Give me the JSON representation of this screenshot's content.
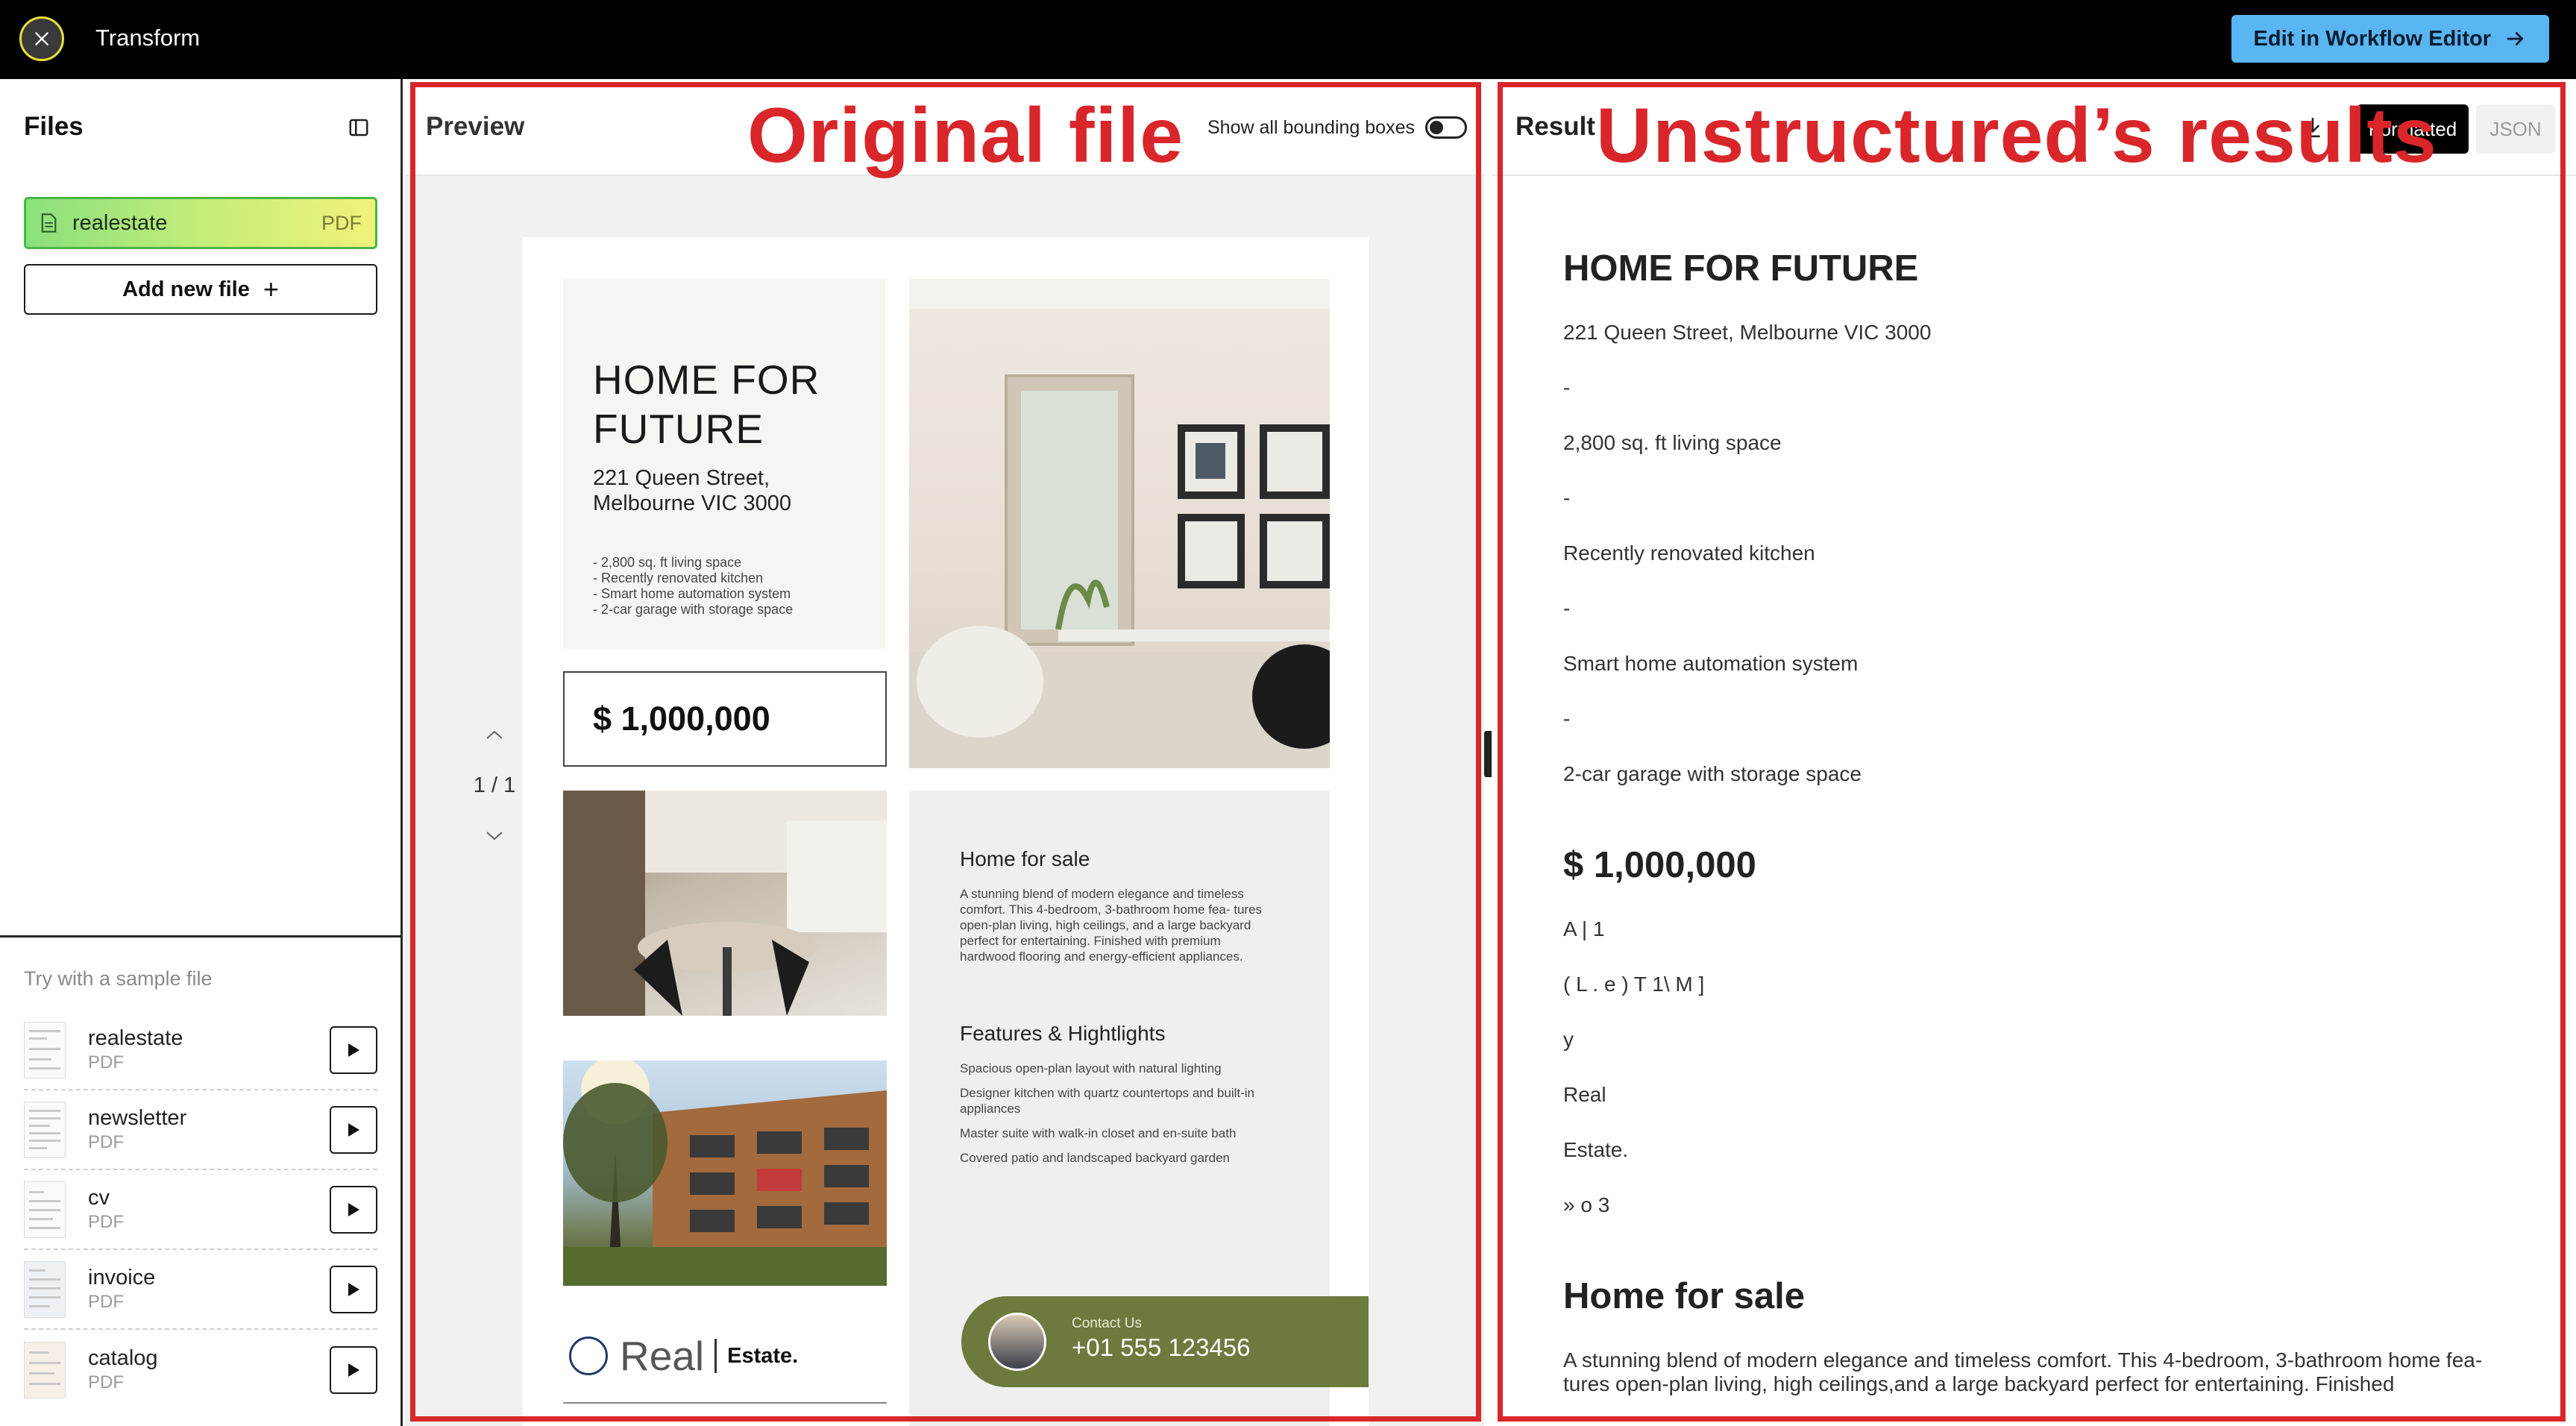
{
  "topbar": {
    "title": "Transform",
    "workflow_button": "Edit in Workflow Editor"
  },
  "sidebar": {
    "title": "Files",
    "active_file": {
      "name": "realestate",
      "type": "PDF"
    },
    "add_file_label": "Add new file",
    "sample_title": "Try with a sample file",
    "samples": [
      {
        "name": "realestate",
        "type": "PDF"
      },
      {
        "name": "newsletter",
        "type": "PDF"
      },
      {
        "name": "cv",
        "type": "PDF"
      },
      {
        "name": "invoice",
        "type": "PDF"
      },
      {
        "name": "catalog",
        "type": "PDF"
      }
    ]
  },
  "preview": {
    "title": "Preview",
    "bbox_label": "Show all bounding boxes",
    "page_count": "1 / 1",
    "document": {
      "heading_line1": "HOME FOR",
      "heading_line2": "FUTURE",
      "address_line1": "221 Queen Street,",
      "address_line2": "Melbourne VIC 3000",
      "bullets": [
        "- 2,800 sq. ft living space",
        "- Recently renovated kitchen",
        "- Smart home automation system",
        "- 2-car garage with storage space"
      ],
      "price": "$ 1,000,000",
      "sale_title": "Home for sale",
      "sale_text": "A stunning blend of modern elegance and timeless comfort. This 4-bedroom, 3-bathroom home fea- tures open-plan living, high ceilings, and a large backyard perfect for entertaining. Finished with premium hardwood flooring and energy-efficient appliances.",
      "features_title": "Features & Hightlights",
      "features": [
        "Spacious open-plan layout with natural lighting",
        "Designer kitchen with quartz countertops and built-in appliances",
        "Master suite with walk-in closet and en-suite bath",
        "Covered patio and landscaped backyard garden"
      ],
      "contact_label": "Contact Us",
      "contact_number": "+01 555 123456",
      "logo_real": "Real",
      "logo_estate": "Estate."
    }
  },
  "result": {
    "title": "Result",
    "tab_formatted": "Formatted",
    "tab_json": "JSON",
    "heading1": "HOME FOR FUTURE",
    "lines": [
      "221 Queen Street, Melbourne VIC 3000",
      "-",
      "2,800 sq. ft living space",
      "-",
      "Recently renovated kitchen",
      "-",
      "Smart home automation system",
      "-",
      "2-car garage with storage space"
    ],
    "price_heading": "$ 1,000,000",
    "ocr_lines": [
      "A | 1",
      "( L . e ) T 1\\ M ]",
      "y",
      "Real",
      "Estate.",
      "» o 3"
    ],
    "heading2": "Home for sale",
    "paragraph": "A stunning blend of modern elegance and timeless comfort. This 4-bedroom, 3-bathroom home fea- tures open-plan living, high ceilings,and a large backyard perfect for entertaining. Finished"
  },
  "annotations": {
    "left": "Original file",
    "right": "Unstructured’s results",
    "color": "#d9262a"
  },
  "colors": {
    "accent_button": "#59b6f2",
    "active_file_border": "#4ab545",
    "contact_band": "#6c7a3d"
  }
}
